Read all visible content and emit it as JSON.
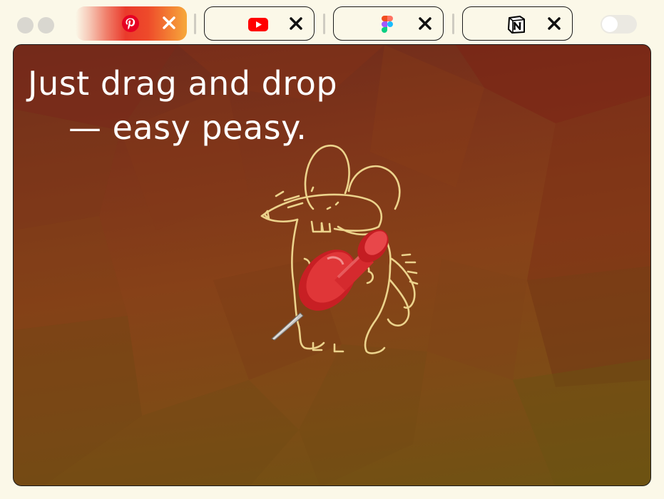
{
  "tabs": [
    {
      "site": "Pinterest",
      "icon": "pinterest-icon",
      "active": true,
      "color": "#e60023"
    },
    {
      "site": "YouTube",
      "icon": "youtube-icon",
      "active": false,
      "color": "#ff0000"
    },
    {
      "site": "Figma",
      "icon": "figma-icon",
      "active": false,
      "color": "#a259ff"
    },
    {
      "site": "Notion",
      "icon": "notion-icon",
      "active": false,
      "color": "#000000"
    }
  ],
  "toggle": {
    "on": false
  },
  "hero": {
    "line1": "Just drag and drop",
    "line2": "— easy peasy."
  },
  "colors": {
    "background": "#fbf8e8",
    "canvas_top": "#6d2a1c",
    "canvas_bottom": "#6e5313",
    "sketch": "#ecd38c",
    "pin": "#d8262a"
  }
}
